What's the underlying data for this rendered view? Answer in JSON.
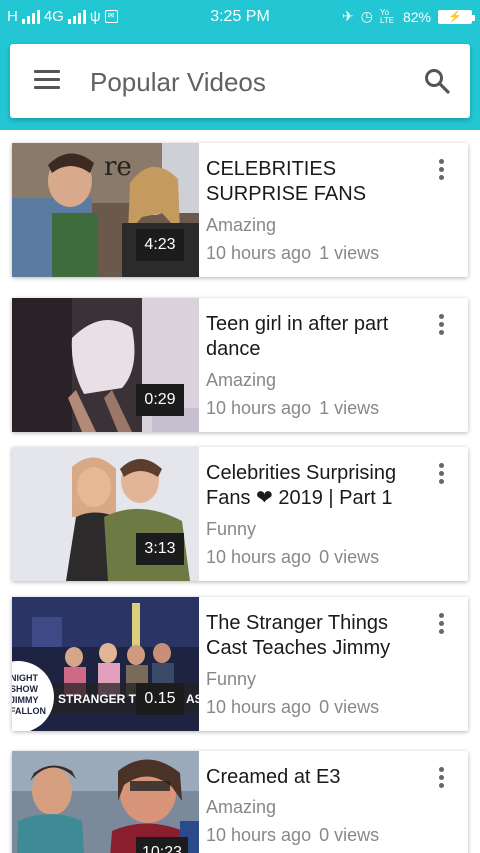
{
  "status_bar": {
    "network_left": "H",
    "network_mid": "4G",
    "time": "3:25 PM",
    "volte": "Yo LTE",
    "battery": "82%"
  },
  "header": {
    "title": "Popular Videos"
  },
  "videos": [
    {
      "title": "CELEBRITIES SURPRISE FANS",
      "category": "Amazing",
      "age": "10 hours ago",
      "views": "1 views",
      "duration": "4:23"
    },
    {
      "title": "Teen girl in after part dance",
      "category": "Amazing",
      "age": "10 hours ago",
      "views": "1 views",
      "duration": "0:29"
    },
    {
      "title": "Celebrities Surprising Fans ❤ 2019 | Part 1",
      "category": "Funny",
      "age": "10 hours ago",
      "views": "0 views",
      "duration": "3:13"
    },
    {
      "title": "The Stranger Things Cast Teaches Jimmy",
      "category": "Funny",
      "age": "10 hours ago",
      "views": "0 views",
      "duration": "0.15",
      "thumb_caption": "STRANGER T",
      "thumb_caption_tail": "AS",
      "thumb_logo": "NIGHT SHOW JIMMY FALLON"
    },
    {
      "title": "Creamed at E3",
      "category": "Amazing",
      "age": "10 hours ago",
      "views": "0 views",
      "duration": "10:23"
    }
  ],
  "colors": {
    "accent": "#23c6d3",
    "title_text": "#616161",
    "meta_text": "#888888"
  }
}
